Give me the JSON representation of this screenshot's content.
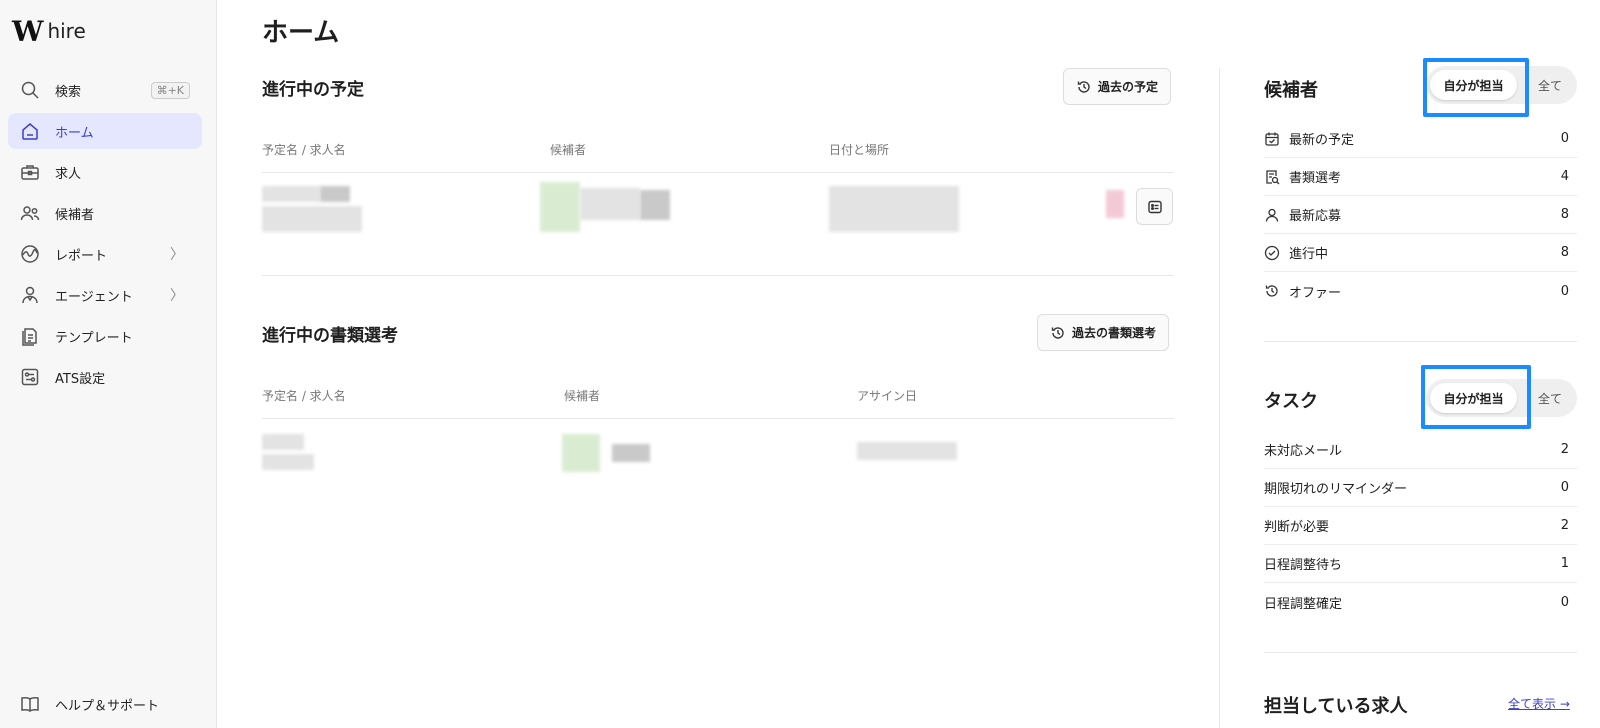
{
  "app": {
    "logo_mark": "W",
    "logo_text": "hire"
  },
  "sidebar": {
    "items": [
      {
        "label": "検索",
        "icon": "search-icon",
        "shortcut": "⌘+K"
      },
      {
        "label": "ホーム",
        "icon": "home-icon",
        "active": true
      },
      {
        "label": "求人",
        "icon": "briefcase-icon"
      },
      {
        "label": "候補者",
        "icon": "users-icon"
      },
      {
        "label": "レポート",
        "icon": "chart-icon",
        "chevron": "〉"
      },
      {
        "label": "エージェント",
        "icon": "agent-icon",
        "chevron": "〉"
      },
      {
        "label": "テンプレート",
        "icon": "template-icon"
      },
      {
        "label": "ATS設定",
        "icon": "settings-icon"
      }
    ],
    "help": {
      "label": "ヘルプ＆サポート",
      "icon": "book-icon"
    }
  },
  "main": {
    "title": "ホーム",
    "schedule": {
      "title": "進行中の予定",
      "past_button": "過去の予定",
      "columns": [
        "予定名 / 求人名",
        "候補者",
        "日付と場所"
      ]
    },
    "screening": {
      "title": "進行中の書類選考",
      "past_button": "過去の書類選考",
      "columns": [
        "予定名 / 求人名",
        "候補者",
        "アサイン日"
      ]
    }
  },
  "right": {
    "candidates": {
      "title": "候補者",
      "toggle_mine": "自分が担当",
      "toggle_all": "全て",
      "rows": [
        {
          "label": "最新の予定",
          "icon": "calendar-check-icon",
          "count": "0"
        },
        {
          "label": "書類選考",
          "icon": "document-search-icon",
          "count": "4"
        },
        {
          "label": "最新応募",
          "icon": "person-icon",
          "count": "8"
        },
        {
          "label": "進行中",
          "icon": "check-circle-icon",
          "count": "8"
        },
        {
          "label": "オファー",
          "icon": "history-icon",
          "count": "0"
        }
      ]
    },
    "tasks": {
      "title": "タスク",
      "toggle_mine": "自分が担当",
      "toggle_all": "全て",
      "rows": [
        {
          "label": "未対応メール",
          "count": "2"
        },
        {
          "label": "期限切れのリマインダー",
          "count": "0"
        },
        {
          "label": "判断が必要",
          "count": "2"
        },
        {
          "label": "日程調整待ち",
          "count": "1"
        },
        {
          "label": "日程調整確定",
          "count": "0"
        }
      ]
    },
    "jobs": {
      "title": "担当している求人",
      "show_all": "全て表示 →"
    }
  },
  "colors": {
    "accent": "#3b3fc9",
    "active_bg": "#e5e6ff",
    "highlight": "#1a8cff"
  }
}
